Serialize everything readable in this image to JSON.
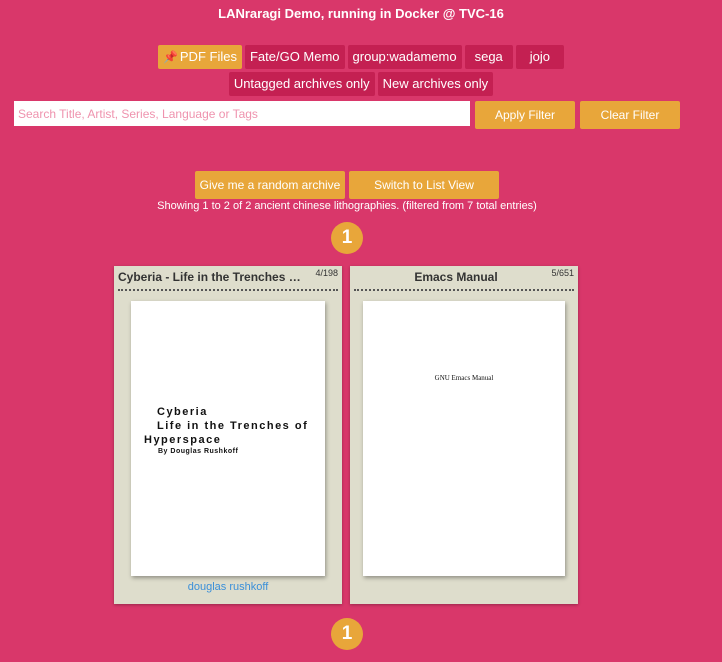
{
  "header": {
    "title": "LANraragi Demo, running in Docker @ TVC-16"
  },
  "categories": {
    "row1": [
      {
        "label": "PDF Files",
        "pinned": true
      },
      {
        "label": "Fate/GO Memo"
      },
      {
        "label": "group:wadamemo"
      },
      {
        "label": "sega"
      },
      {
        "label": "jojo"
      }
    ],
    "row2": [
      {
        "label": "Untagged archives only"
      },
      {
        "label": "New archives only"
      }
    ]
  },
  "search": {
    "placeholder": "Search Title, Artist, Series, Language or Tags",
    "value": "",
    "apply_label": "Apply Filter",
    "clear_label": "Clear Filter"
  },
  "actions": {
    "random_label": "Give me a random archive",
    "list_view_label": "Switch to List View"
  },
  "results": {
    "summary": "Showing 1 to 2 of 2 ancient chinese lithographies. (filtered from 7 total entries)"
  },
  "pagination": {
    "current_page": "1"
  },
  "archives": [
    {
      "title": "Cyberia - Life in the Trenches of Hyperspace",
      "page_count": "4/198",
      "cover_lines": [
        "Cyberia",
        "Life in the Trenches of",
        "Hyperspace"
      ],
      "cover_author": "By Douglas Rushkoff",
      "tag": "douglas rushkoff"
    },
    {
      "title": "Emacs Manual",
      "page_count": "5/651",
      "cover_text": "GNU Emacs Manual",
      "tag": ""
    }
  ],
  "colors": {
    "background": "#d9376a",
    "button": "#e8a63a",
    "category": "#c42052",
    "card": "#deddcc",
    "link": "#3a8fd9"
  },
  "icons": {
    "pin": "pushpin-icon"
  }
}
